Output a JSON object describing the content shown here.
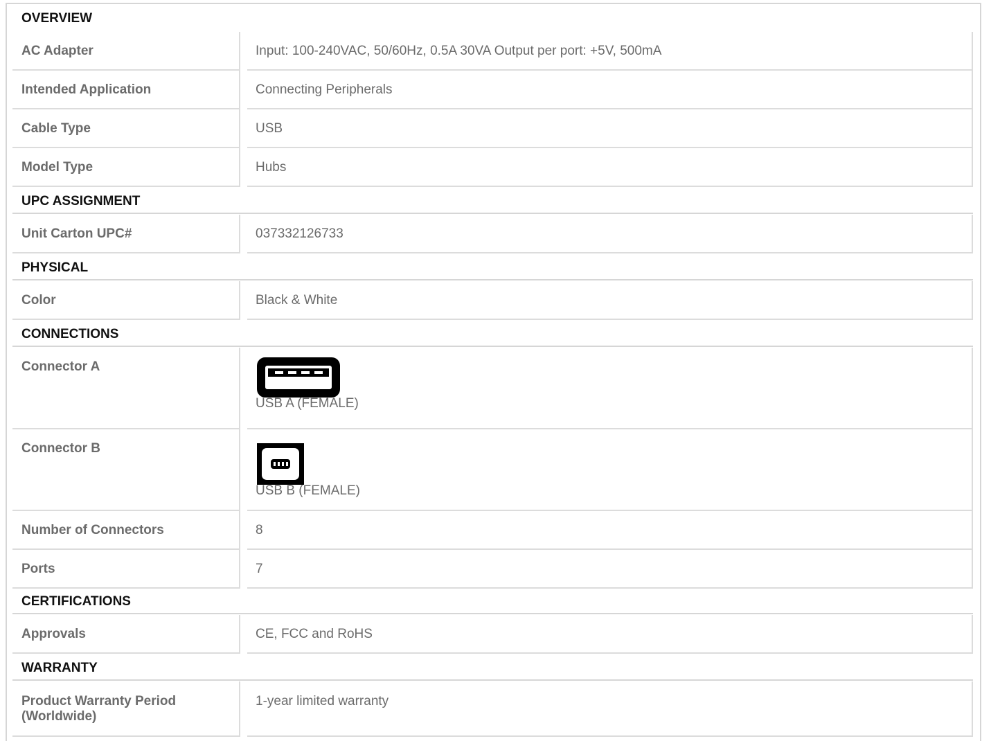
{
  "sections": [
    {
      "title": "OVERVIEW",
      "rows": [
        {
          "label": "AC Adapter",
          "value": "Input: 100-240VAC, 50/60Hz, 0.5A 30VA Output per port: +5V, 500mA"
        },
        {
          "label": "Intended Application",
          "value": "Connecting Peripherals"
        },
        {
          "label": "Cable Type",
          "value": "USB"
        },
        {
          "label": "Model Type",
          "value": "Hubs"
        }
      ]
    },
    {
      "title": "UPC ASSIGNMENT",
      "rows": [
        {
          "label": "Unit Carton UPC#",
          "value": "037332126733"
        }
      ]
    },
    {
      "title": "PHYSICAL",
      "rows": [
        {
          "label": "Color",
          "value": "Black & White"
        }
      ]
    },
    {
      "title": "CONNECTIONS",
      "rows": [
        {
          "label": "Connector A",
          "value": "USB A (FEMALE)",
          "icon": "usb-a-port-icon"
        },
        {
          "label": "Connector B",
          "value": "USB B (FEMALE)",
          "icon": "usb-b-port-icon"
        },
        {
          "label": "Number of Connectors",
          "value": "8"
        },
        {
          "label": "Ports",
          "value": "7"
        }
      ]
    },
    {
      "title": "CERTIFICATIONS",
      "rows": [
        {
          "label": "Approvals",
          "value": "CE, FCC and RoHS"
        }
      ]
    },
    {
      "title": "WARRANTY",
      "rows": [
        {
          "label": "Product Warranty Period (Worldwide)",
          "value": "1-year limited warranty"
        }
      ]
    }
  ],
  "colors": {
    "label_text": "#6b6b6b",
    "section_text": "#111111",
    "border": "#d6d6d6",
    "icon": "#000000"
  }
}
